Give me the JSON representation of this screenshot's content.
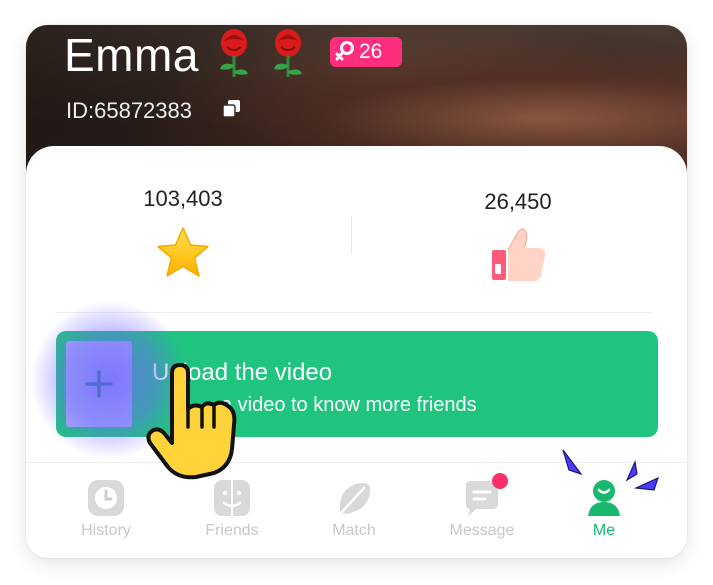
{
  "profile": {
    "name": "Emma",
    "id_label": "ID:65872383",
    "badge_count": "26"
  },
  "stats": {
    "left_value": "103,403",
    "right_value": "26,450"
  },
  "upload": {
    "title": "Upload the video",
    "subtitle": "Upload a video to know more friends",
    "subtitle_visible": "a video to know more friends"
  },
  "tabs": [
    {
      "label": "History",
      "icon": "history-icon",
      "active": false
    },
    {
      "label": "Friends",
      "icon": "friends-icon",
      "active": false
    },
    {
      "label": "Match",
      "icon": "match-icon",
      "active": false
    },
    {
      "label": "Message",
      "icon": "message-icon",
      "active": false,
      "notification_dot": true
    },
    {
      "label": "Me",
      "icon": "me-icon",
      "active": true
    }
  ],
  "colors": {
    "accent_green": "#1fc57e",
    "badge_pink": "#ff2d7e",
    "highlight_purple": "#a8aef7",
    "notification_red": "#ff2d6a"
  }
}
